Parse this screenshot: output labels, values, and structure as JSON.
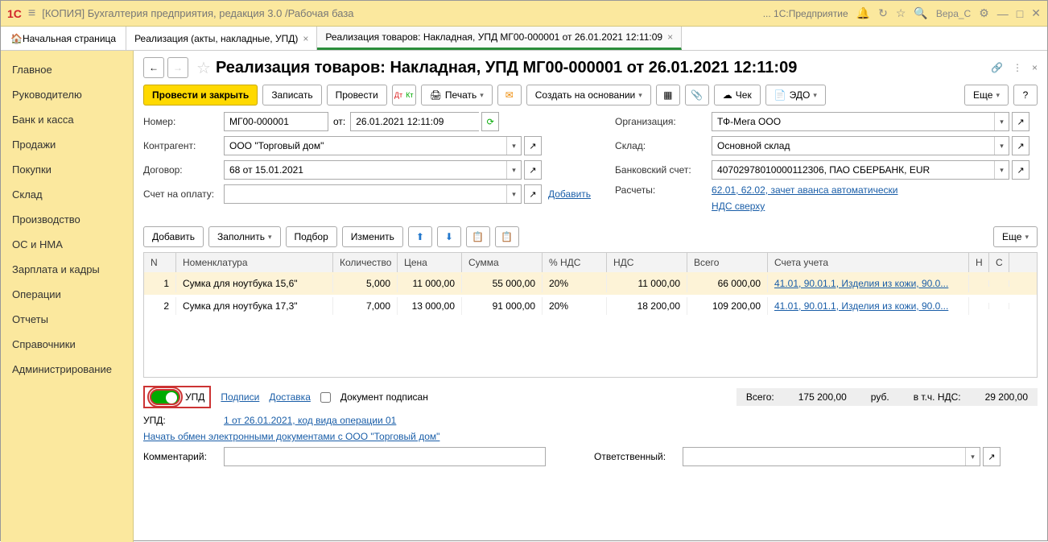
{
  "topbar": {
    "app_title": "[КОПИЯ] Бухгалтерия предприятия, редакция 3.0 /Рабочая база",
    "suffix": "... 1С:Предприятие",
    "user": "Вера_С"
  },
  "tabs": {
    "home": "Начальная страница",
    "t1": "Реализация (акты, накладные, УПД)",
    "t2": "Реализация товаров: Накладная, УПД МГ00-000001 от 26.01.2021 12:11:09"
  },
  "sidebar": {
    "items": [
      "Главное",
      "Руководителю",
      "Банк и касса",
      "Продажи",
      "Покупки",
      "Склад",
      "Производство",
      "ОС и НМА",
      "Зарплата и кадры",
      "Операции",
      "Отчеты",
      "Справочники",
      "Администрирование"
    ]
  },
  "page": {
    "title": "Реализация товаров: Накладная, УПД МГ00-000001 от 26.01.2021 12:11:09"
  },
  "toolbar": {
    "post_close": "Провести и закрыть",
    "save": "Записать",
    "post": "Провести",
    "print": "Печать",
    "create_based": "Создать на основании",
    "check": "Чек",
    "edo": "ЭДО",
    "more": "Еще"
  },
  "form": {
    "number_label": "Номер:",
    "number": "МГ00-000001",
    "from": "от:",
    "date": "26.01.2021 12:11:09",
    "org_label": "Организация:",
    "org": "ТФ-Мега ООО",
    "contra_label": "Контрагент:",
    "contra": "ООО \"Торговый дом\"",
    "store_label": "Склад:",
    "store": "Основной склад",
    "contract_label": "Договор:",
    "contract": "68 от 15.01.2021",
    "bank_label": "Банковский счет:",
    "bank": "40702978010000112306, ПАО СБЕРБАНК, EUR",
    "invoice_label": "Счет на оплату:",
    "add_link": "Добавить",
    "calc_label": "Расчеты:",
    "calc_link": "62.01, 62.02, зачет аванса автоматически",
    "vat_link": "НДС сверху"
  },
  "tbl_toolbar": {
    "add": "Добавить",
    "fill": "Заполнить",
    "select": "Подбор",
    "change": "Изменить",
    "more": "Еще"
  },
  "grid": {
    "headers": {
      "n": "N",
      "nom": "Номенклатура",
      "qty": "Количество",
      "price": "Цена",
      "sum": "Сумма",
      "vatpct": "% НДС",
      "vat": "НДС",
      "total": "Всего",
      "acc": "Счета учета",
      "h": "Н",
      "c": "С"
    },
    "rows": [
      {
        "n": "1",
        "nom": "Сумка для ноутбука 15,6\"",
        "qty": "5,000",
        "price": "11 000,00",
        "sum": "55 000,00",
        "vatpct": "20%",
        "vat": "11 000,00",
        "total": "66 000,00",
        "acc": "41.01, 90.01.1, Изделия из кожи, 90.0..."
      },
      {
        "n": "2",
        "nom": "Сумка для ноутбука 17,3\"",
        "qty": "7,000",
        "price": "13 000,00",
        "sum": "91 000,00",
        "vatpct": "20%",
        "vat": "18 200,00",
        "total": "109 200,00",
        "acc": "41.01, 90.01.1, Изделия из кожи, 90.0..."
      }
    ]
  },
  "footer": {
    "upd": "УПД",
    "sign": "Подписи",
    "delivery": "Доставка",
    "doc_signed": "Документ подписан",
    "total_label": "Всего:",
    "total": "175 200,00",
    "rub": "руб.",
    "vat_label": "в т.ч. НДС:",
    "vat": "29 200,00",
    "upd_label": "УПД:",
    "upd_link": "1 от 26.01.2021, код вида операции 01",
    "edo_link": "Начать обмен электронными документами с ООО \"Торговый дом\"",
    "comment_label": "Комментарий:",
    "resp_label": "Ответственный:"
  }
}
